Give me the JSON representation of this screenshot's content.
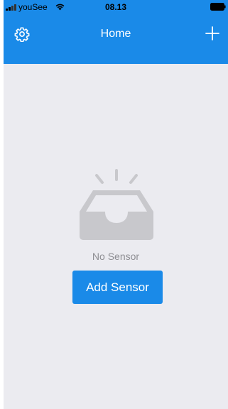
{
  "status_bar": {
    "carrier": "youSee",
    "time": "08.13"
  },
  "nav": {
    "title": "Home",
    "settings_icon": "gear-icon",
    "add_icon": "plus-icon"
  },
  "empty_state": {
    "illustration": "inbox-icon",
    "message": "No Sensor",
    "button_label": "Add Sensor"
  },
  "colors": {
    "accent": "#1a8ae8",
    "background": "#ebebf0",
    "muted_text": "#8e8e93",
    "illustration": "#c8c8cc"
  }
}
